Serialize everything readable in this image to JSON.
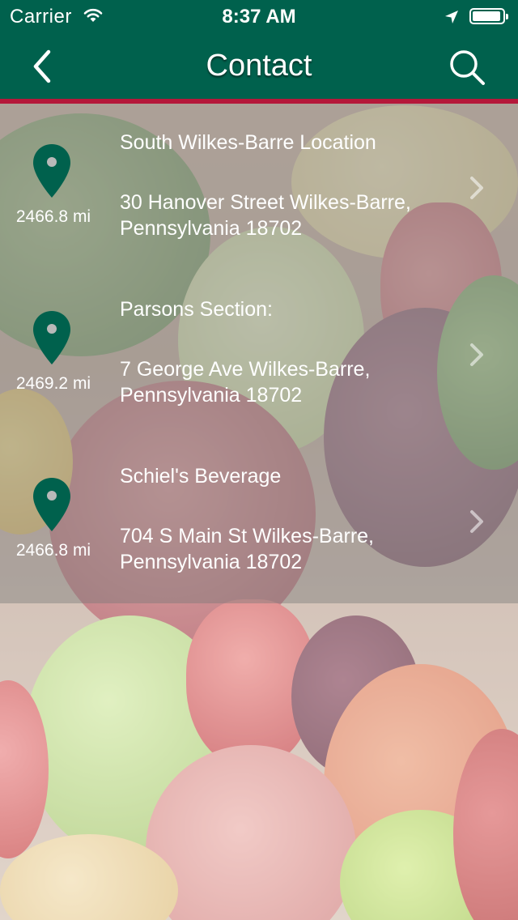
{
  "status_bar": {
    "carrier": "Carrier",
    "time": "8:37 AM",
    "battery_level": 0.95
  },
  "nav": {
    "title": "Contact",
    "back_icon": "chevron-left-icon",
    "search_icon": "search-icon"
  },
  "colors": {
    "header": "#00614d",
    "accent": "#b5183a",
    "pin": "#00614d"
  },
  "locations": [
    {
      "distance": "2466.8 mi",
      "name": "South Wilkes-Barre Location",
      "address": "30 Hanover Street Wilkes-Barre, Pennsylvania 18702"
    },
    {
      "distance": "2469.2 mi",
      "name": "Parsons Section:",
      "address": "7 George Ave Wilkes-Barre, Pennsylvania 18702"
    },
    {
      "distance": "2466.8 mi",
      "name": "Schiel's Beverage",
      "address": "704 S Main St Wilkes-Barre, Pennsylvania 18702"
    }
  ]
}
